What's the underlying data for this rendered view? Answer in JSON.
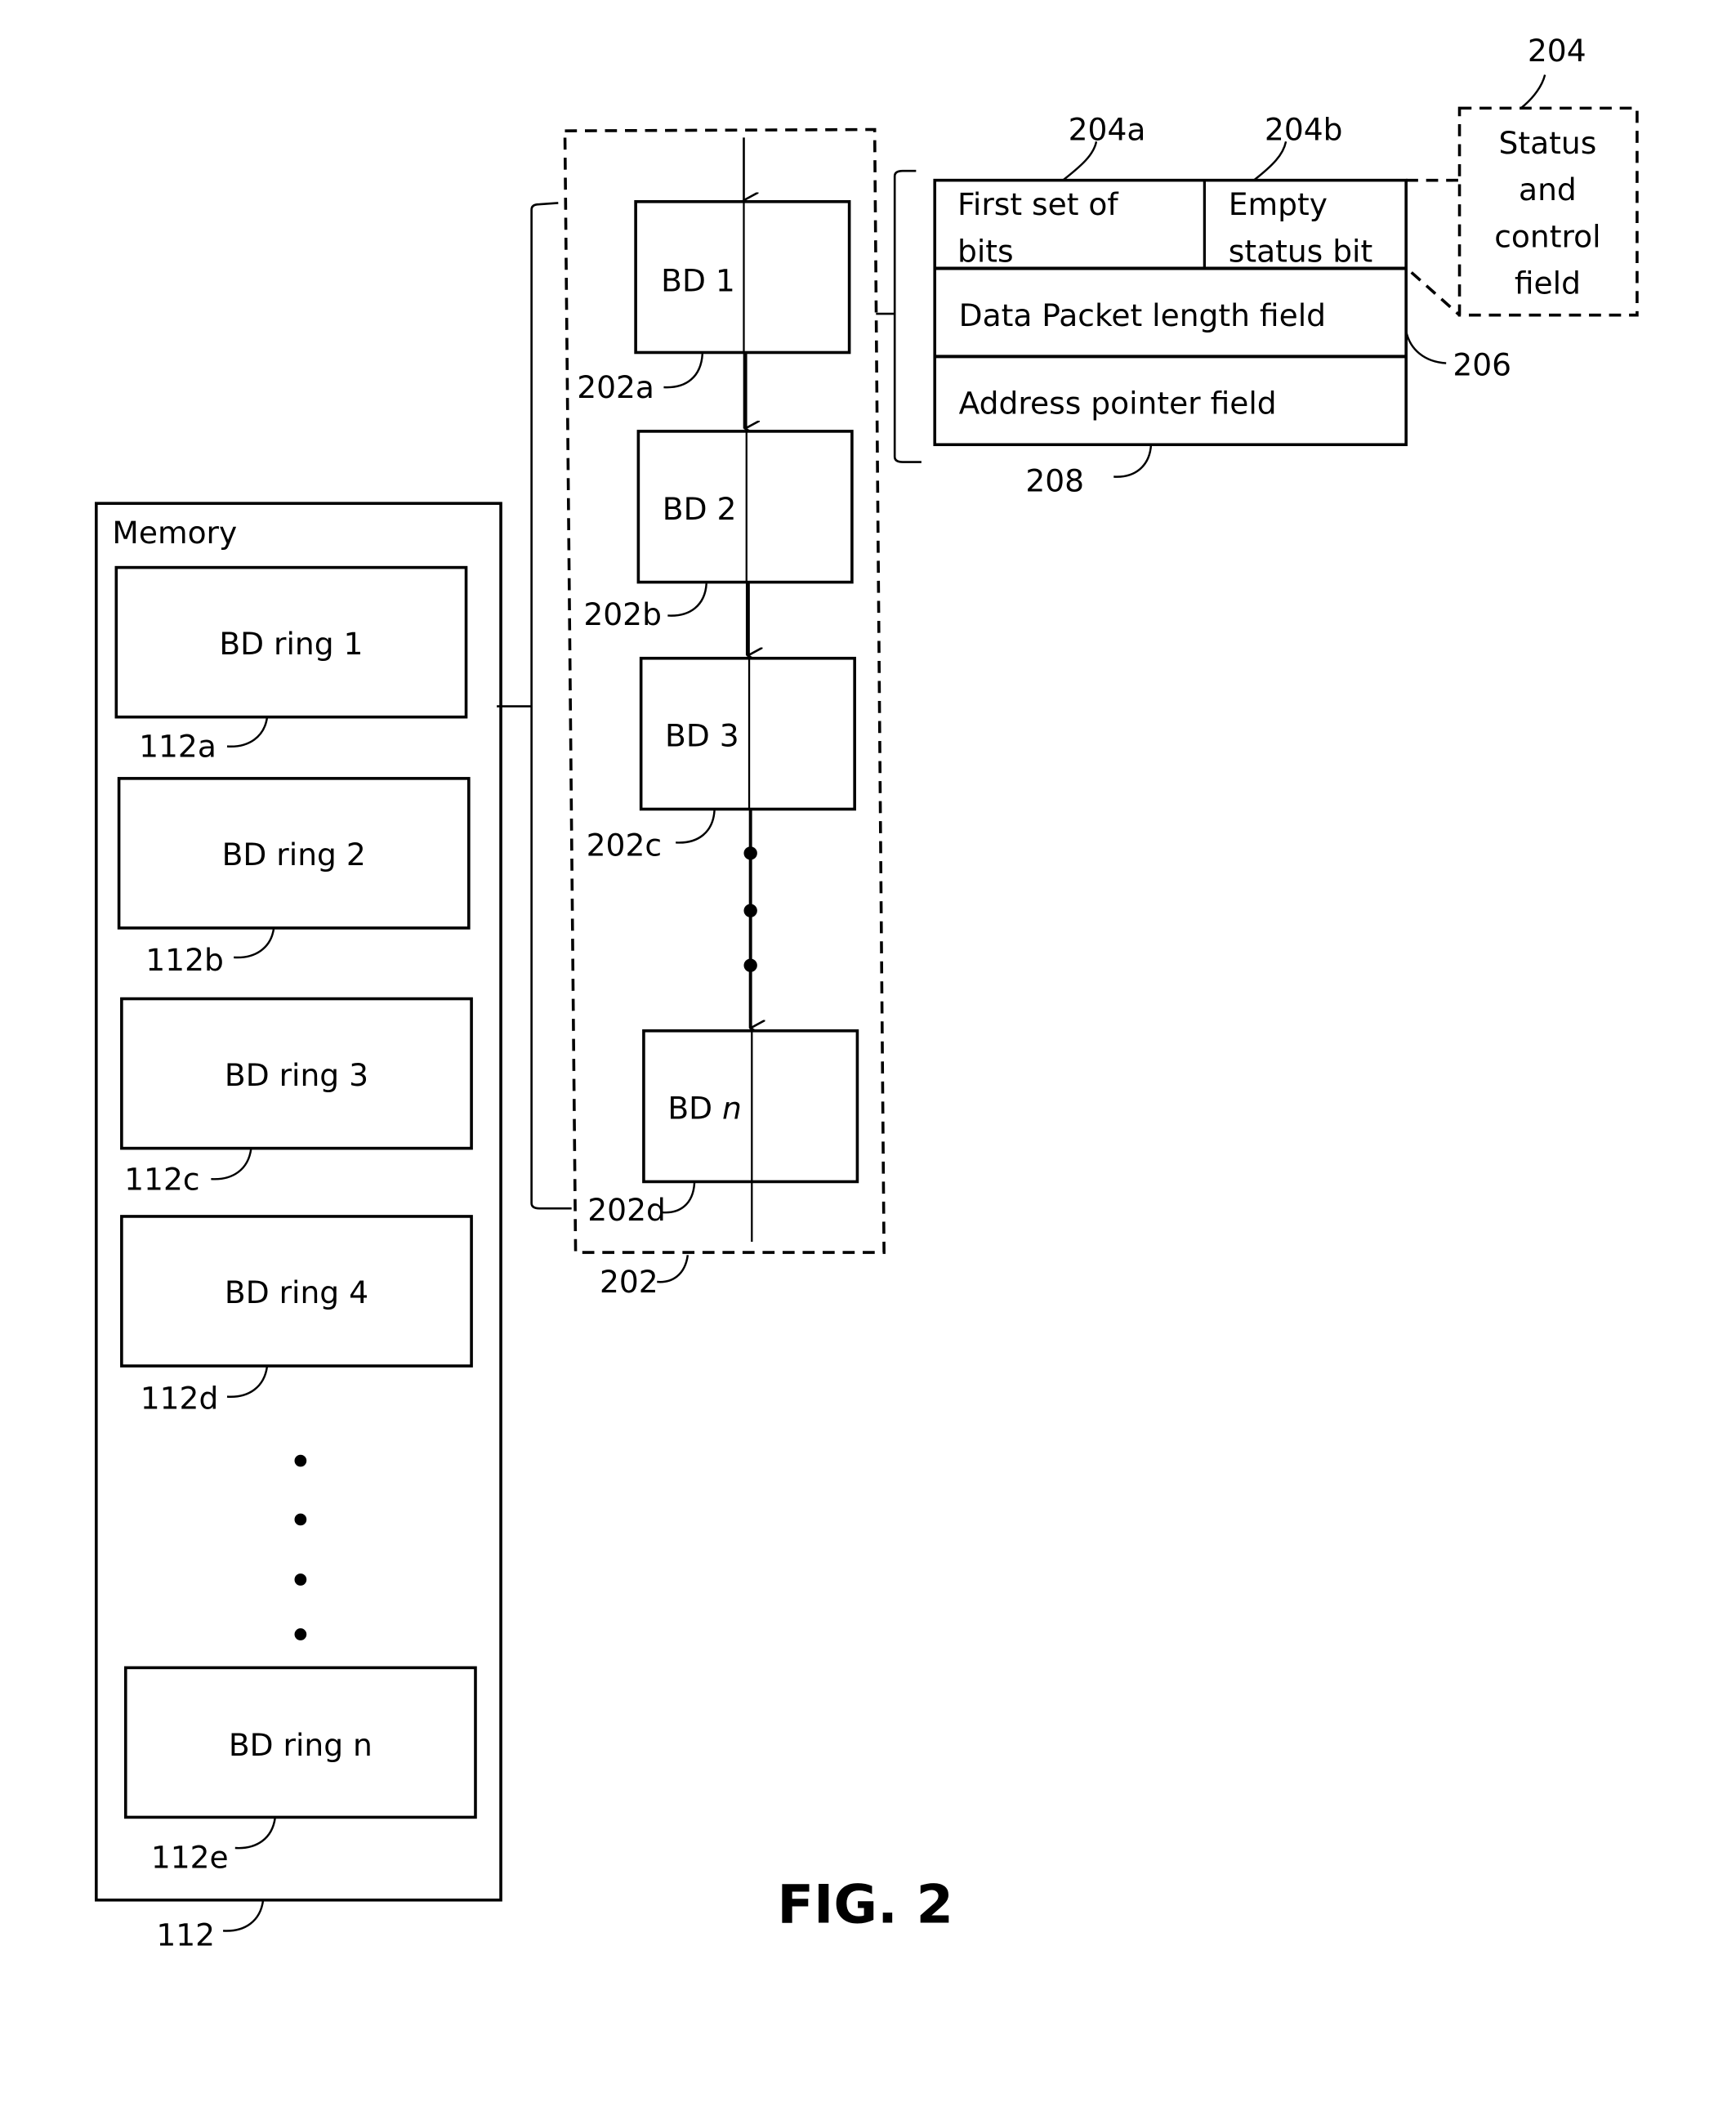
{
  "figure": {
    "title": "FIG. 2",
    "memory": {
      "label": "Memory",
      "ref": "112",
      "rings": [
        {
          "label": "BD ring 1",
          "ref": "112a"
        },
        {
          "label": "BD ring 2",
          "ref": "112b"
        },
        {
          "label": "BD ring 3",
          "ref": "112c"
        },
        {
          "label": "BD ring 4",
          "ref": "112d"
        },
        {
          "label": "BD ring n",
          "ref": "112e"
        }
      ]
    },
    "bd_ring": {
      "ref": "202",
      "descriptors": [
        {
          "label": "BD 1",
          "ref": "202a"
        },
        {
          "label": "BD 2",
          "ref": "202b"
        },
        {
          "label": "BD 3",
          "ref": "202c"
        },
        {
          "label": "BD ",
          "label_italic": "n",
          "ref": "202d"
        }
      ]
    },
    "descriptor_fields": {
      "status_control": {
        "ref": "204",
        "label_lines": [
          "Status",
          "and",
          "control",
          "field"
        ]
      },
      "first_set": {
        "ref": "204a",
        "label_lines": [
          "First set of",
          "bits"
        ]
      },
      "empty_status": {
        "ref": "204b",
        "label_lines": [
          "Empty",
          "status bit"
        ]
      },
      "data_length": {
        "ref": "206",
        "label": "Data Packet length field"
      },
      "address_pointer": {
        "ref": "208",
        "label": "Address pointer field"
      }
    }
  }
}
